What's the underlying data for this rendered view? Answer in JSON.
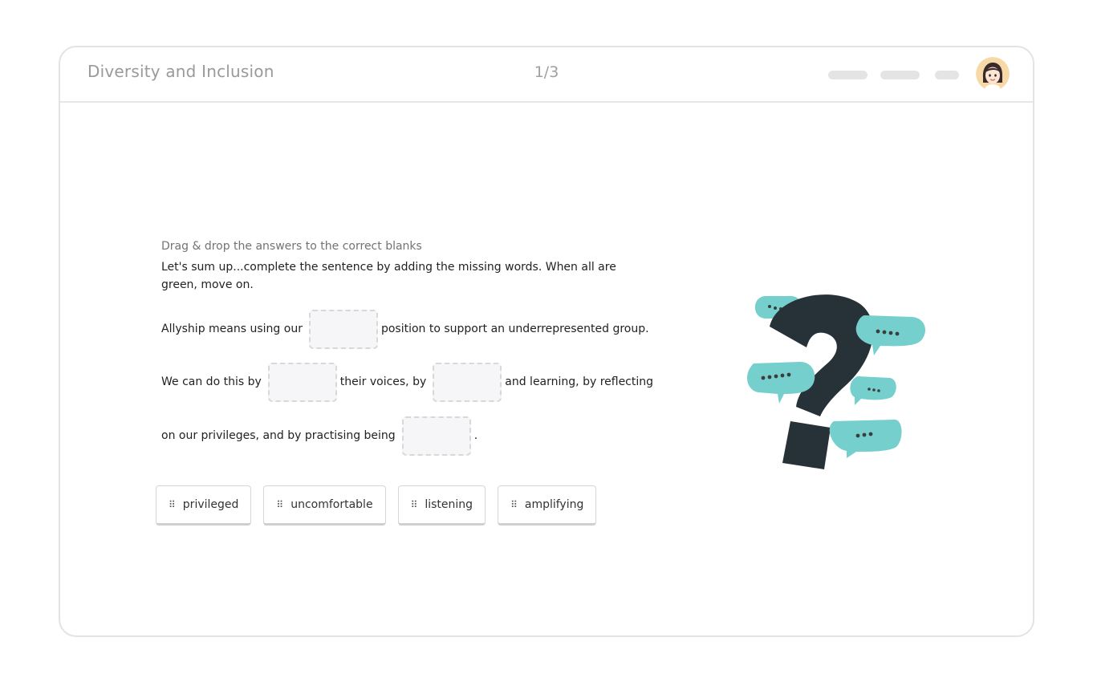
{
  "header": {
    "title": "Diversity and Inclusion",
    "progress": "1/3"
  },
  "activity": {
    "instruction": "Drag & drop the answers to the correct blanks",
    "prompt": "Let's sum up...complete the sentence by adding the missing words. When all are green, move on.",
    "line1": {
      "before": "Allyship means using our",
      "after": "position to support an underrepresented group."
    },
    "line2": {
      "before": "We can do this by",
      "middle": "their voices, by",
      "after": "and learning, by reflecting"
    },
    "line3": {
      "before": "on our privileges, and by practising being",
      "after": "."
    }
  },
  "answers": [
    {
      "label": "privileged"
    },
    {
      "label": "uncomfortable"
    },
    {
      "label": "listening"
    },
    {
      "label": "amplifying"
    }
  ],
  "colors": {
    "accent_teal": "#74cfcd",
    "question_mark": "#263238"
  },
  "icons": {
    "grip": "⠿"
  }
}
